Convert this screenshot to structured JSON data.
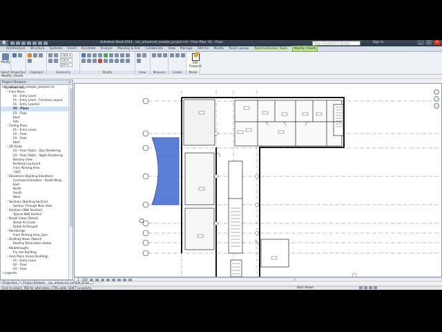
{
  "titlebar": {
    "logo": "R",
    "title": "Autodesk Revit 2014 - rac_advanced_sample_project.rvt - Floor Plan: 02 - Floor",
    "search_placeholder": "Type a keyword or phrase",
    "signin": "Sign In",
    "min": "_",
    "max": "□",
    "close": "×"
  },
  "tabs": [
    {
      "label": "Architecture",
      "kind": "normal"
    },
    {
      "label": "Structure",
      "kind": "normal"
    },
    {
      "label": "Systems",
      "kind": "normal"
    },
    {
      "label": "Insert",
      "kind": "normal"
    },
    {
      "label": "Annotate",
      "kind": "normal"
    },
    {
      "label": "Analyze",
      "kind": "normal"
    },
    {
      "label": "Massing & Site",
      "kind": "normal"
    },
    {
      "label": "Collaborate",
      "kind": "normal"
    },
    {
      "label": "View",
      "kind": "normal"
    },
    {
      "label": "Manage",
      "kind": "normal"
    },
    {
      "label": "Add-Ins",
      "kind": "normal"
    },
    {
      "label": "Modify",
      "kind": "normal"
    },
    {
      "label": "Revit Lookup",
      "kind": "normal"
    },
    {
      "label": "Revit Extension Tools",
      "kind": "context"
    },
    {
      "label": "Modify | Roofs",
      "kind": "active"
    }
  ],
  "ribbon": {
    "modify_label": "Modify",
    "select_label": "Select ▾",
    "properties_label": "Properties",
    "clipboard_label": "Clipboard",
    "geometry_label": "Geometry",
    "cope_label": "Cope ▾",
    "cut_label": "Cut ▾",
    "join_label": "Join ▾",
    "modify_panel_label": "Modify",
    "view_label": "View",
    "measure_label": "Measure",
    "create_label": "Create",
    "mode_label": "Mode",
    "edit_footprint_label": "Edit Footprint"
  },
  "modbar": {
    "text": "Modify | Roofs"
  },
  "browser": {
    "title": "Project Browser - rac_advanced_sample_project.rvt",
    "close": "×",
    "items": [
      {
        "label": "[0] Views (all)",
        "level": 0,
        "toggle": "−",
        "selected": false
      },
      {
        "label": "Floor Plans",
        "level": 1,
        "toggle": "−",
        "selected": false
      },
      {
        "label": "01 - Entry Level",
        "level": 2,
        "toggle": "",
        "selected": false
      },
      {
        "label": "01 - Entry Level - Furniture Layout",
        "level": 2,
        "toggle": "",
        "selected": false
      },
      {
        "label": "01 - Entry Level(2)",
        "level": 2,
        "toggle": "",
        "selected": false
      },
      {
        "label": "02 - Floor",
        "level": 2,
        "toggle": "",
        "selected": true
      },
      {
        "label": "03 - Floor",
        "level": 2,
        "toggle": "",
        "selected": false
      },
      {
        "label": "Roof",
        "level": 2,
        "toggle": "",
        "selected": false
      },
      {
        "label": "Site",
        "level": 2,
        "toggle": "",
        "selected": false
      },
      {
        "label": "Ceiling Plans",
        "level": 1,
        "toggle": "−",
        "selected": false
      },
      {
        "label": "01 - Entry Level",
        "level": 2,
        "toggle": "",
        "selected": false
      },
      {
        "label": "02 - Floor",
        "level": 2,
        "toggle": "",
        "selected": false
      },
      {
        "label": "03 - Floor",
        "level": 2,
        "toggle": "",
        "selected": false
      },
      {
        "label": "Roof",
        "level": 2,
        "toggle": "",
        "selected": false
      },
      {
        "label": "3D Views",
        "level": 1,
        "toggle": "−",
        "selected": false
      },
      {
        "label": "03 - Floor Public - Day Rendering",
        "level": 2,
        "toggle": "",
        "selected": false
      },
      {
        "label": "03 - Floor Public - Night Rendering",
        "level": 2,
        "toggle": "",
        "selected": false
      },
      {
        "label": "Balcony View",
        "level": 2,
        "toggle": "",
        "selected": false
      },
      {
        "label": "Building Courtyard",
        "level": 2,
        "toggle": "",
        "selected": false
      },
      {
        "label": "From Parking Area",
        "level": 2,
        "toggle": "",
        "selected": false
      },
      {
        "label": "{3D}",
        "level": 2,
        "toggle": "",
        "selected": false
      },
      {
        "label": "Elevations (Building Elevation)",
        "level": 1,
        "toggle": "−",
        "selected": false
      },
      {
        "label": "Courtyard Elevation - South Wing",
        "level": 2,
        "toggle": "",
        "selected": false
      },
      {
        "label": "East",
        "level": 2,
        "toggle": "",
        "selected": false
      },
      {
        "label": "North",
        "level": 2,
        "toggle": "",
        "selected": false
      },
      {
        "label": "South",
        "level": 2,
        "toggle": "",
        "selected": false
      },
      {
        "label": "West",
        "level": 2,
        "toggle": "",
        "selected": false
      },
      {
        "label": "Sections (Building Section)",
        "level": 1,
        "toggle": "−",
        "selected": false
      },
      {
        "label": "Section Through Main Stair",
        "level": 2,
        "toggle": "",
        "selected": false
      },
      {
        "label": "Sections (Wall Section)",
        "level": 1,
        "toggle": "−",
        "selected": false
      },
      {
        "label": "Typical Wall Section",
        "level": 2,
        "toggle": "",
        "selected": false
      },
      {
        "label": "Detail Views (Detail)",
        "level": 1,
        "toggle": "−",
        "selected": false
      },
      {
        "label": "Detail At Grade",
        "level": 2,
        "toggle": "",
        "selected": false
      },
      {
        "label": "Detail At Parapet",
        "level": 2,
        "toggle": "",
        "selected": false
      },
      {
        "label": "Renderings",
        "level": 1,
        "toggle": "−",
        "selected": false
      },
      {
        "label": "From Parking Area_2pm",
        "level": 2,
        "toggle": "",
        "selected": false
      },
      {
        "label": "Drafting Views (Detail)",
        "level": 1,
        "toggle": "−",
        "selected": false
      },
      {
        "label": "Roofing Termination Detail",
        "level": 2,
        "toggle": "",
        "selected": false
      },
      {
        "label": "Walkthroughs",
        "level": 1,
        "toggle": "−",
        "selected": false
      },
      {
        "label": "Fly into Building",
        "level": 2,
        "toggle": "",
        "selected": false
      },
      {
        "label": "Area Plans (Gross Building)",
        "level": 1,
        "toggle": "−",
        "selected": false
      },
      {
        "label": "01 - Entry Level",
        "level": 2,
        "toggle": "",
        "selected": false
      },
      {
        "label": "02 - Floor",
        "level": 2,
        "toggle": "",
        "selected": false
      },
      {
        "label": "03 - Floor",
        "level": 2,
        "toggle": "",
        "selected": false
      },
      {
        "label": "Legends",
        "level": 0,
        "toggle": "+",
        "selected": false
      }
    ]
  },
  "prop_tabs": [
    "Properties",
    "Project Browser - rac_advanced_sample_proje..."
  ],
  "view_control": {
    "scale": "1 : 100"
  },
  "status": {
    "text": "Click to select, TAB for alternates, CTRL adds, SHIFT unselects.",
    "model": "Main Model",
    "zero": ":0"
  },
  "grid_labels": [
    "A",
    "B",
    "C",
    "D",
    "E",
    "F",
    "G",
    "H",
    "I",
    "J"
  ],
  "colors": {
    "selected_roof": "#5b7fd6",
    "accent_tab": "#b8e08e"
  }
}
